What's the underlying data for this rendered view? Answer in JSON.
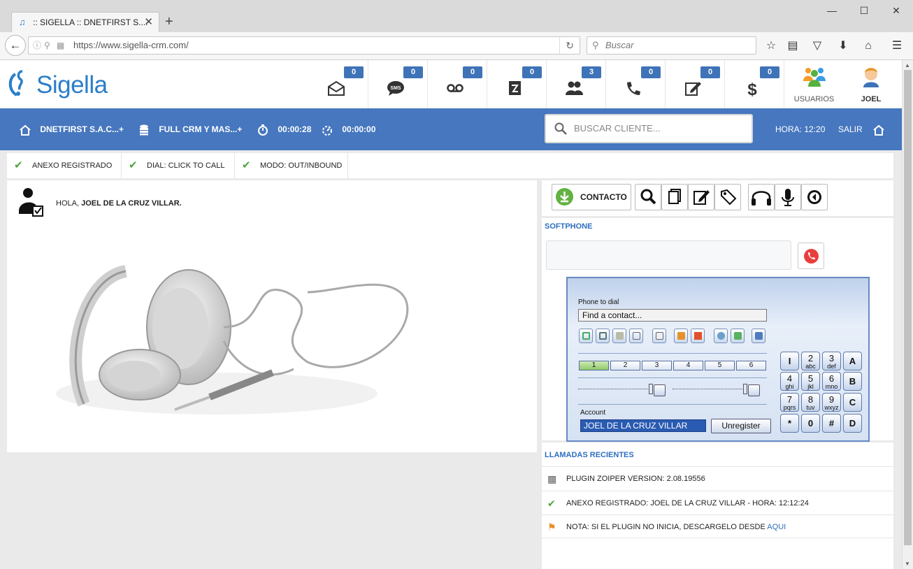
{
  "browser": {
    "tab_title": ":: SIGELLA :: DNETFIRST S....",
    "url": "https://www.sigella-crm.com/",
    "search_placeholder": "Buscar"
  },
  "header": {
    "logo_text": "Sigella",
    "counters": [
      {
        "name": "email",
        "count": "0",
        "icon": "envelope-icon"
      },
      {
        "name": "sms",
        "count": "0",
        "icon": "sms-icon",
        "icon_text": "SMS"
      },
      {
        "name": "voicemail",
        "count": "0",
        "icon": "voicemail-icon"
      },
      {
        "name": "tasks",
        "count": "0",
        "icon": "notebook-icon"
      },
      {
        "name": "users-online",
        "count": "3",
        "icon": "users-icon"
      },
      {
        "name": "calls",
        "count": "0",
        "icon": "phone-icon"
      },
      {
        "name": "notes",
        "count": "0",
        "icon": "edit-icon"
      },
      {
        "name": "sales",
        "count": "0",
        "icon": "dollar-icon"
      }
    ],
    "users_label": "USUARIOS",
    "user_label": "JOEL"
  },
  "bluebar": {
    "company": "DNETFIRST S.A.C...+",
    "plan": "FULL CRM Y MAS...+",
    "timer1": "00:00:28",
    "timer2": "00:00:00",
    "search_placeholder": "BUSCAR CLIENTE...",
    "time_label": "HORA: 12:20",
    "logout": "SALIR"
  },
  "status": {
    "items": [
      "ANEXO REGISTRADO",
      "DIAL: CLICK TO CALL",
      "MODO: OUT/INBOUND"
    ]
  },
  "greeting": {
    "prefix": "HOLA, ",
    "name": "JOEL DE LA CRUZ VILLAR."
  },
  "toolbar": {
    "contact_label": "CONTACTO"
  },
  "softphone": {
    "title": "SOFTPHONE",
    "phone_to_dial_label": "Phone to dial",
    "find_contact": "Find a contact...",
    "lines": [
      "1",
      "2",
      "3",
      "4",
      "5",
      "6"
    ],
    "account_label": "Account",
    "account_value": "JOEL DE LA CRUZ VILLAR",
    "unregister": "Unregister",
    "keys": [
      {
        "d": "I",
        "s": ""
      },
      {
        "d": "2",
        "s": "abc"
      },
      {
        "d": "3",
        "s": "def"
      },
      {
        "d": "A",
        "s": ""
      },
      {
        "d": "4",
        "s": "ghi"
      },
      {
        "d": "5",
        "s": "jkl"
      },
      {
        "d": "6",
        "s": "mno"
      },
      {
        "d": "B",
        "s": ""
      },
      {
        "d": "7",
        "s": "pqrs"
      },
      {
        "d": "8",
        "s": "tuv"
      },
      {
        "d": "9",
        "s": "wxyz"
      },
      {
        "d": "C",
        "s": ""
      },
      {
        "d": "*",
        "s": ""
      },
      {
        "d": "0",
        "s": ""
      },
      {
        "d": "#",
        "s": ""
      },
      {
        "d": "D",
        "s": ""
      }
    ]
  },
  "recent": {
    "title": "LLAMADAS RECIENTES",
    "items": [
      {
        "text": "PLUGIN ZOIPER VERSION: 2.08.19556"
      },
      {
        "text": "ANEXO REGISTRADO: JOEL DE LA CRUZ VILLAR - HORA: 12:12:24"
      },
      {
        "text": "NOTA: SI EL PLUGIN NO INICIA, DESCARGELO DESDE ",
        "link": "AQUI"
      }
    ]
  }
}
